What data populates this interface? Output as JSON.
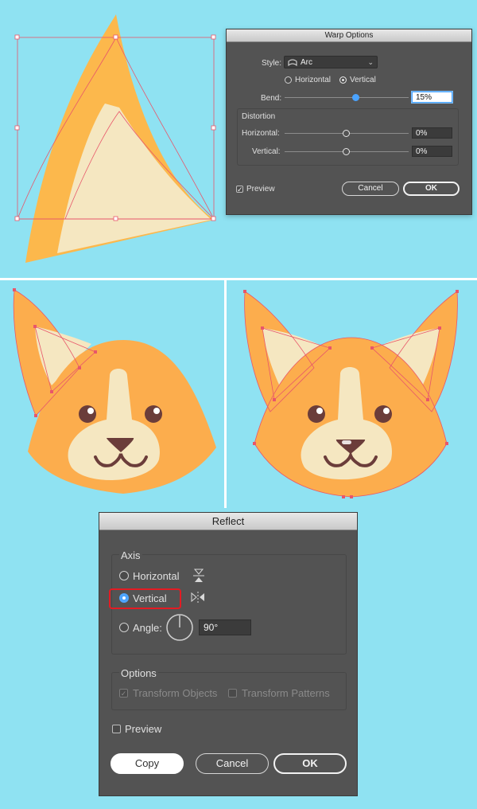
{
  "colors": {
    "background": "#8fe2f2",
    "fur_orange": "#fcad4d",
    "fur_dark_orange": "#fdb545",
    "cream": "#f5e7c1",
    "brown": "#6b3d3a",
    "selection": "#e8566a",
    "dialog_bg": "#535353",
    "slider_knob_active": "#4aa3ff",
    "highlight_red": "#e41b23"
  },
  "warp_dialog": {
    "title": "Warp Options",
    "style_label": "Style:",
    "style_value": "Arc",
    "style_icon": "arc-shape-icon",
    "orientation": {
      "horizontal_label": "Horizontal",
      "vertical_label": "Vertical",
      "selected": "Vertical"
    },
    "bend_label": "Bend:",
    "bend_value": "15%",
    "bend_level": 0.575,
    "distortion_title": "Distortion",
    "horizontal_label": "Horizontal:",
    "horizontal_value": "0%",
    "horizontal_level": 0.5,
    "vertical_label": "Vertical:",
    "vertical_value": "0%",
    "vertical_level": 0.5,
    "preview_label": "Preview",
    "preview_checked": true,
    "cancel_label": "Cancel",
    "ok_label": "OK"
  },
  "reflect_dialog": {
    "title": "Reflect",
    "axis_title": "Axis",
    "horizontal_label": "Horizontal",
    "vertical_label": "Vertical",
    "angle_label": "Angle:",
    "angle_value": "90°",
    "selected": "Vertical",
    "horizontal_icon": "reflect-horizontal-icon",
    "vertical_icon": "reflect-vertical-icon",
    "angle_icon": "angle-dial-icon",
    "options_title": "Options",
    "transform_objects_label": "Transform Objects",
    "transform_objects_checked": true,
    "transform_patterns_label": "Transform Patterns",
    "transform_patterns_checked": false,
    "preview_label": "Preview",
    "preview_checked": false,
    "copy_label": "Copy",
    "cancel_label": "Cancel",
    "ok_label": "OK"
  }
}
